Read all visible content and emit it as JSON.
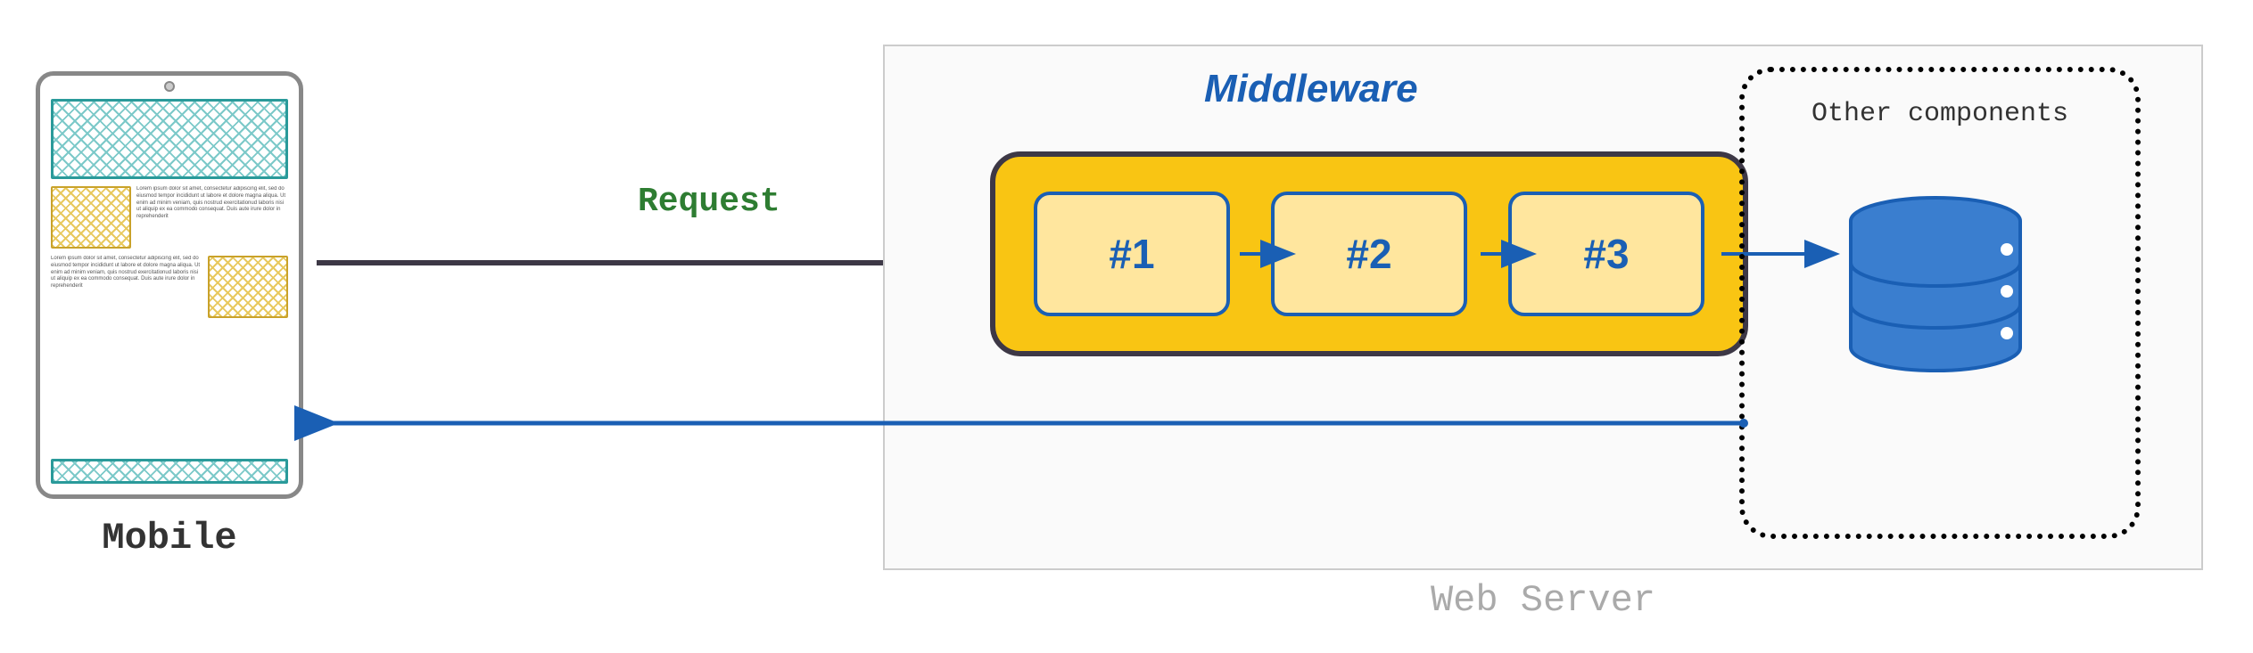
{
  "mobile": {
    "label": "Mobile",
    "placeholder_text": "Lorem ipsum dolor sit amet, consectetur adipiscing elit, sed do eiusmod tempor incididunt ut labore et dolore magna aliqua. Ut enim ad minim veniam, quis nostrud exercitationud laboris nisi ut aliquip ex ea commodo consequat. Duis aute irure dolor in reprehenderit"
  },
  "request": {
    "label": "Request"
  },
  "web_server": {
    "label": "Web Server"
  },
  "middleware": {
    "label": "Middleware",
    "items": [
      "#1",
      "#2",
      "#3"
    ]
  },
  "other_components": {
    "label": "Other components"
  },
  "colors": {
    "middleware_bg": "#f9c513",
    "middleware_item_bg": "#ffe69e",
    "middleware_border": "#1a5fb4",
    "request_arrow": "#3d3846",
    "response_arrow": "#1a5fb4",
    "request_text": "#2e7d32"
  }
}
